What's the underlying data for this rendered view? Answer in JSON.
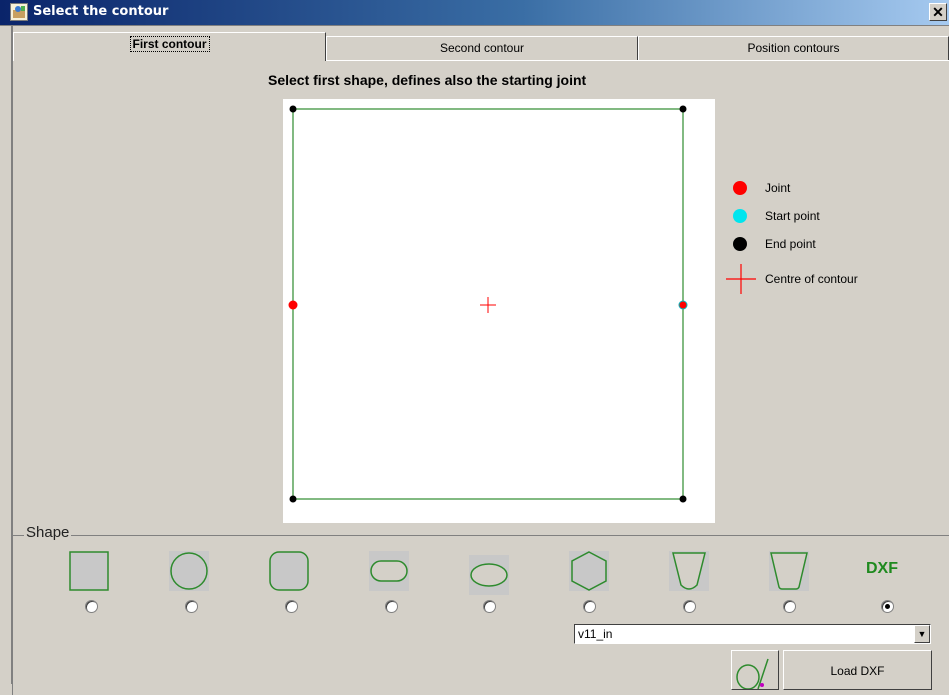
{
  "window": {
    "title": "Select the contour",
    "close_glyph": "✕"
  },
  "tabs": [
    {
      "label": "First contour",
      "active": true
    },
    {
      "label": "Second contour",
      "active": false
    },
    {
      "label": "Position contours",
      "active": false
    }
  ],
  "instruction": "Select first shape, defines also the starting joint",
  "legend": {
    "joint": "Joint",
    "start_point": "Start point",
    "end_point": "End point",
    "centre": "Centre of contour"
  },
  "colors": {
    "joint": "#ff0000",
    "start_point": "#00e5ee",
    "end_point": "#000000",
    "centre": "#ff0000",
    "contour": "#2e8b2e"
  },
  "shape_group": {
    "legend": "Shape",
    "options": [
      {
        "icon": "square-shape-icon",
        "selected": false
      },
      {
        "icon": "circle-shape-icon",
        "selected": false
      },
      {
        "icon": "rounded-square-shape-icon",
        "selected": false
      },
      {
        "icon": "rounded-rectangle-shape-icon",
        "selected": false
      },
      {
        "icon": "ellipse-shape-icon",
        "selected": false
      },
      {
        "icon": "hexagon-shape-icon",
        "selected": false
      },
      {
        "icon": "rounded-trapezoid-shape-icon",
        "selected": false
      },
      {
        "icon": "trapezoid-shape-icon",
        "selected": false
      },
      {
        "icon": "dxf-shape-icon",
        "selected": true
      }
    ],
    "dxf_label": "DXF",
    "dxf_file": {
      "value": "v11_in"
    },
    "load_button": "Load DXF"
  }
}
